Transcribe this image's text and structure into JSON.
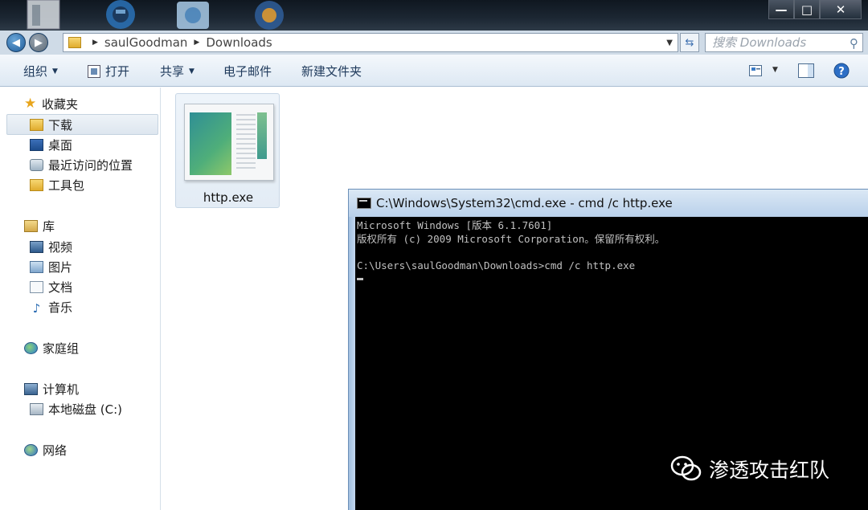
{
  "explorer": {
    "window_controls": {
      "minimize": "—",
      "maximize": "□",
      "close": "✕"
    },
    "breadcrumb": [
      "saulGoodman",
      "Downloads"
    ],
    "search_placeholder": "搜索 Downloads",
    "toolbar": {
      "organize": "组织",
      "open": "打开",
      "share": "共享",
      "email": "电子邮件",
      "new_folder": "新建文件夹"
    },
    "sidebar": {
      "favorites": "收藏夹",
      "favorites_items": [
        "下载",
        "桌面",
        "最近访问的位置",
        "工具包"
      ],
      "libraries": "库",
      "library_items": [
        "视频",
        "图片",
        "文档",
        "音乐"
      ],
      "homegroup": "家庭组",
      "computer": "计算机",
      "computer_items": [
        "本地磁盘 (C:)"
      ],
      "network": "网络"
    },
    "files": [
      {
        "name": "http.exe",
        "icon": "application-icon"
      }
    ]
  },
  "cmd": {
    "title": "C:\\Windows\\System32\\cmd.exe - cmd  /c http.exe",
    "lines": [
      "Microsoft Windows [版本 6.1.7601]",
      "版权所有 (c) 2009 Microsoft Corporation。保留所有权利。",
      "",
      "C:\\Users\\saulGoodman\\Downloads>cmd /c http.exe"
    ]
  },
  "watermark": {
    "text": "渗透攻击红队"
  }
}
